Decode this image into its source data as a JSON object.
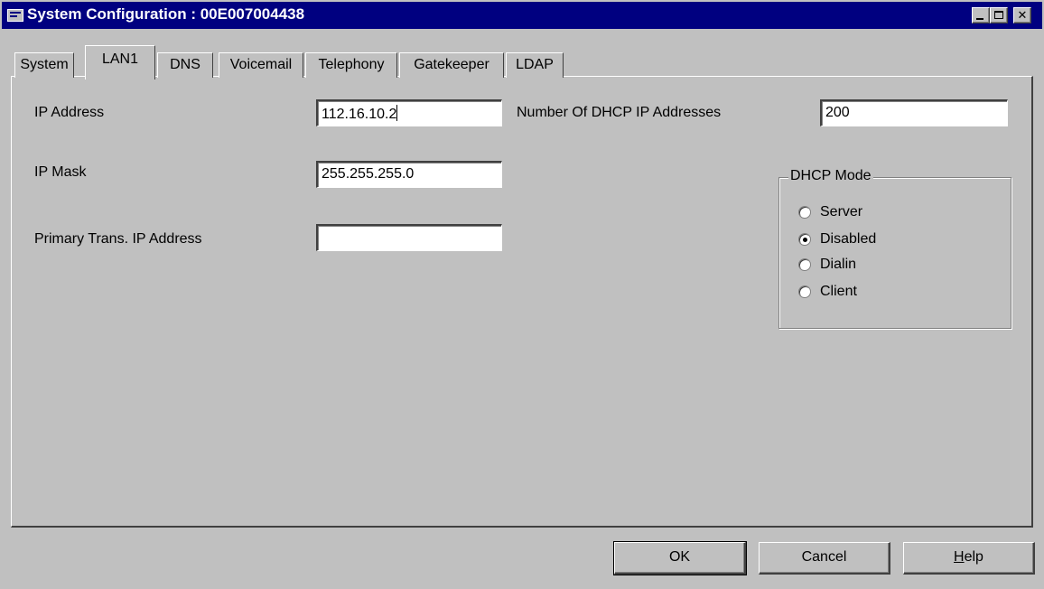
{
  "window": {
    "title": "System Configuration : 00E007004438"
  },
  "tabs": [
    {
      "label": "System"
    },
    {
      "label": "LAN1",
      "active": true
    },
    {
      "label": "DNS"
    },
    {
      "label": "Voicemail"
    },
    {
      "label": "Telephony"
    },
    {
      "label": "Gatekeeper"
    },
    {
      "label": "LDAP"
    }
  ],
  "form": {
    "ip_address": {
      "label": "IP Address",
      "value": "112.16.10.2"
    },
    "ip_mask": {
      "label": "IP Mask",
      "value": "255.255.255.0"
    },
    "primary_trans_ip": {
      "label": "Primary Trans. IP Address",
      "value": ""
    },
    "dhcp_count": {
      "label": "Number Of DHCP IP Addresses",
      "value": "200"
    }
  },
  "dhcp_mode": {
    "legend": "DHCP Mode",
    "options": [
      {
        "label": "Server",
        "selected": false
      },
      {
        "label": "Disabled",
        "selected": true
      },
      {
        "label": "Dialin",
        "selected": false
      },
      {
        "label": "Client",
        "selected": false
      }
    ]
  },
  "buttons": {
    "ok": "OK",
    "cancel": "Cancel",
    "help_u": "H",
    "help_rest": "elp"
  }
}
